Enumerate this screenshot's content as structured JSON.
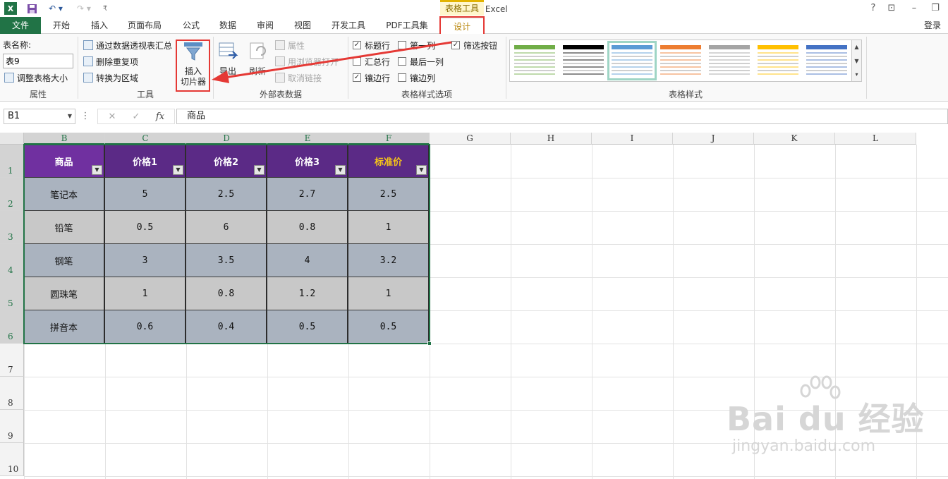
{
  "window": {
    "title": "百度.xlsx - Excel",
    "context_tool": "表格工具",
    "help": "?",
    "login": "登录"
  },
  "tabs": [
    "文件",
    "开始",
    "插入",
    "页面布局",
    "公式",
    "数据",
    "审阅",
    "视图",
    "开发工具",
    "PDF工具集",
    "设计"
  ],
  "ribbon": {
    "properties": {
      "table_name_label": "表名称:",
      "table_name_value": "表9",
      "resize": "调整表格大小",
      "group": "属性"
    },
    "tools": {
      "pivot": "通过数据透视表汇总",
      "remove_dup": "删除重复项",
      "convert": "转换为区域",
      "slicer_line1": "插入",
      "slicer_line2": "切片器",
      "group": "工具"
    },
    "external": {
      "export": "导出",
      "refresh": "刷新",
      "properties": "属性",
      "open_browser": "用浏览器打开",
      "unlink": "取消链接",
      "group": "外部表数据"
    },
    "style_options": {
      "header_row": "标题行",
      "first_col": "第一列",
      "filter_btn": "筛选按钮",
      "total_row": "汇总行",
      "last_col": "最后一列",
      "banded_rows": "镶边行",
      "banded_cols": "镶边列",
      "group": "表格样式选项"
    },
    "styles": {
      "group": "表格样式",
      "accent_colors": [
        "#70ad47",
        "#000000",
        "#5b9bd5",
        "#ed7d31",
        "#a5a5a5",
        "#ffc000",
        "#4472c4"
      ]
    }
  },
  "formula_bar": {
    "name_box": "B1",
    "fx": "fx",
    "cancel": "✕",
    "confirm": "✓",
    "content": "商品"
  },
  "sheet": {
    "columns": [
      "B",
      "C",
      "D",
      "E",
      "F",
      "G",
      "H",
      "I",
      "J",
      "K",
      "L"
    ],
    "rows": [
      "1",
      "2",
      "3",
      "4",
      "5",
      "6",
      "7",
      "8",
      "9",
      "10"
    ],
    "table": {
      "headers": [
        "商品",
        "价格1",
        "价格2",
        "价格3",
        "标准价"
      ],
      "rows": [
        [
          "笔记本",
          "5",
          "2.5",
          "2.7",
          "2.5"
        ],
        [
          "铅笔",
          "0.5",
          "6",
          "0.8",
          "1"
        ],
        [
          "钢笔",
          "3",
          "3.5",
          "4",
          "3.2"
        ],
        [
          "圆珠笔",
          "1",
          "0.8",
          "1.2",
          "1"
        ],
        [
          "拼音本",
          "0.6",
          "0.4",
          "0.5",
          "0.5"
        ]
      ]
    }
  },
  "watermark": {
    "main": "Bai du 经验",
    "sub": "jingyan.baidu.com"
  }
}
